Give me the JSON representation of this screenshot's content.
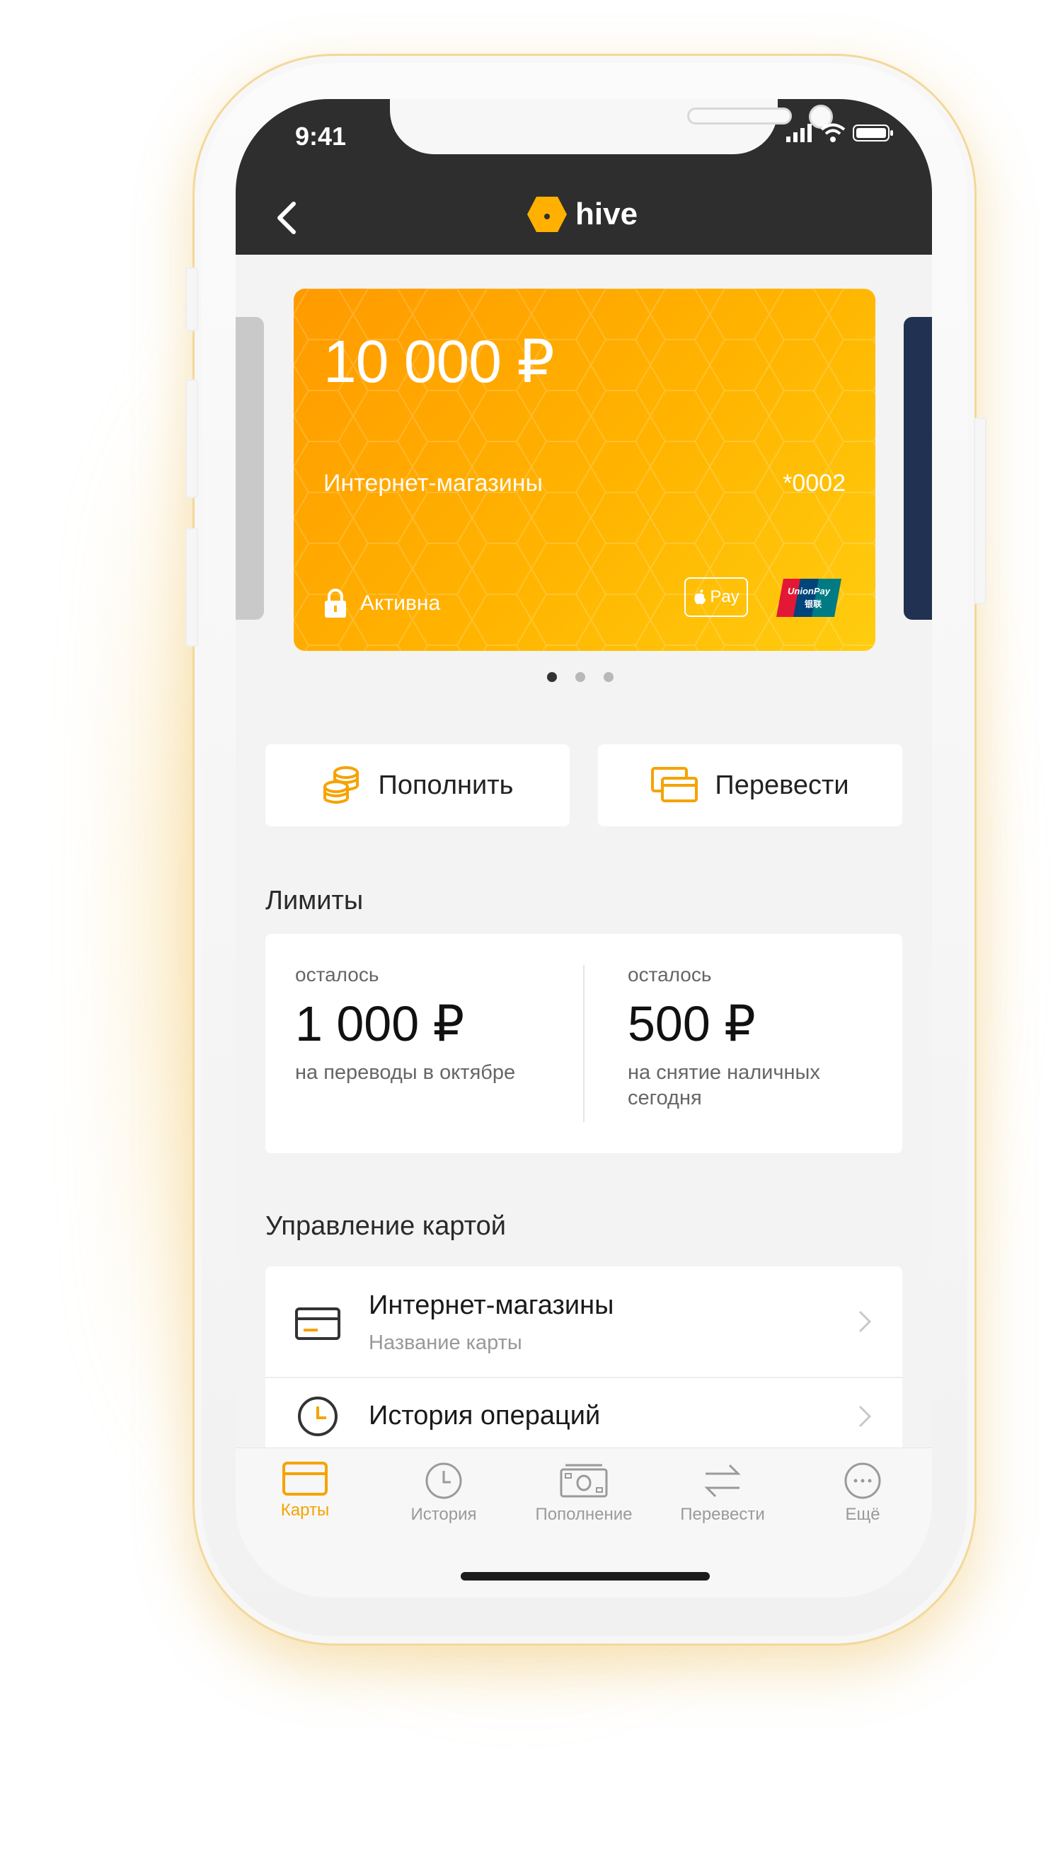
{
  "status_bar": {
    "time": "9:41"
  },
  "header": {
    "brand": "hive"
  },
  "card": {
    "amount": "10 000 ₽",
    "name": "Интернет-магазины",
    "number": "*0002",
    "status": "Активна",
    "applepay_label": "Pay",
    "color_start": "#ff9a00",
    "color_end": "#ffcd10"
  },
  "carousel": {
    "count": 3,
    "active_index": 0
  },
  "actions": {
    "topup_label": "Пополнить",
    "transfer_label": "Перевести"
  },
  "limits": {
    "title": "Лимиты",
    "items": [
      {
        "label": "осталось",
        "value": "1 000 ₽",
        "description": "на переводы в октябре"
      },
      {
        "label": "осталось",
        "value": "500 ₽",
        "description": "на снятие наличных сегодня"
      }
    ]
  },
  "manage": {
    "title": "Управление картой",
    "items": [
      {
        "title": "Интернет-магазины",
        "subtitle": "Название карты",
        "icon": "card-icon"
      },
      {
        "title": "История операций",
        "subtitle": "",
        "icon": "clock-icon"
      }
    ]
  },
  "tabbar": {
    "items": [
      {
        "label": "Карты",
        "icon": "card-icon",
        "active": true
      },
      {
        "label": "История",
        "icon": "clock-icon",
        "active": false
      },
      {
        "label": "Пополнение",
        "icon": "banknote-icon",
        "active": false
      },
      {
        "label": "Перевести",
        "icon": "transfer-arrows-icon",
        "active": false
      },
      {
        "label": "Ещё",
        "icon": "more-icon",
        "active": false
      }
    ]
  },
  "colors": {
    "accent": "#f5a300",
    "header_bg": "#2e2e2e",
    "screen_bg": "#f3f3f3"
  }
}
